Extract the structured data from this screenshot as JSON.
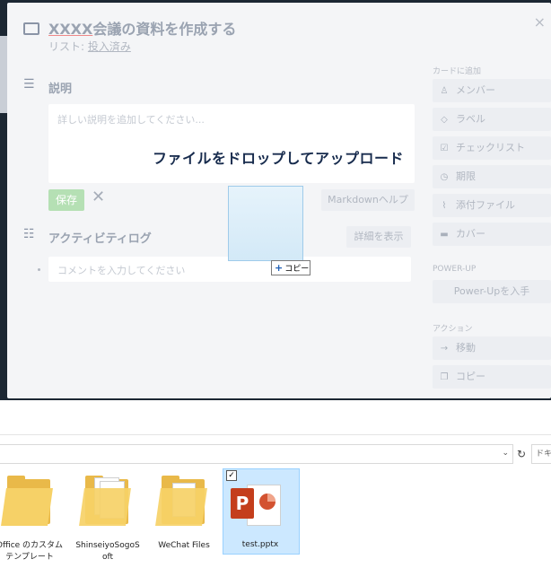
{
  "card": {
    "title_prefix": "XXXX",
    "title_rest": "会議の資料を作成する",
    "list_label": "リスト:",
    "list_name": "投入済み",
    "close": "×"
  },
  "description": {
    "heading": "説明",
    "placeholder": "詳しい説明を追加してください...",
    "drop_message": "ファイルをドロップしてアップロード",
    "save": "保存",
    "cancel": "✕",
    "markdown_help": "Markdownヘルプ"
  },
  "activity": {
    "heading": "アクティビティログ",
    "show_details": "詳細を表示",
    "comment_placeholder": "コメントを入力してください"
  },
  "drag": {
    "plus": "+",
    "copy_label": "コピー"
  },
  "sidebar": {
    "add_to_card_heading": "カードに追加",
    "items": [
      {
        "label": "メンバー",
        "icon": "person-icon"
      },
      {
        "label": "ラベル",
        "icon": "tag-icon"
      },
      {
        "label": "チェックリスト",
        "icon": "checkbox-icon"
      },
      {
        "label": "期限",
        "icon": "clock-icon"
      },
      {
        "label": "添付ファイル",
        "icon": "paperclip-icon"
      },
      {
        "label": "カバー",
        "icon": "cover-icon"
      }
    ],
    "powerup_heading": "POWER-UP",
    "powerup_button": "Power-Upを入手",
    "actions_heading": "アクション",
    "actions": [
      {
        "label": "移動",
        "icon": "arrow-right-icon"
      },
      {
        "label": "コピー",
        "icon": "copy-icon"
      }
    ]
  },
  "explorer": {
    "refresh": "↻",
    "search_fragment": "ドキ",
    "files": [
      {
        "label_line1": "Office のカスタム",
        "label_line2": "テンプレート",
        "type": "folder"
      },
      {
        "label_line1": "ShinseiyoSogoS",
        "label_line2": "oft",
        "type": "folder-with-docs"
      },
      {
        "label_line1": "WeChat Files",
        "label_line2": "",
        "type": "folder-with-docs"
      },
      {
        "label_line1": "test.pptx",
        "label_line2": "",
        "type": "pptx",
        "selected": true
      }
    ],
    "pptx_letter": "P",
    "checkmark": "✓"
  },
  "colors": {
    "brand_dark": "#172b4d",
    "save_green": "#b5e0b4",
    "ppt_red": "#c43e1c",
    "folder_yellow": "#f6d167",
    "selection_blue": "#cce8ff"
  }
}
